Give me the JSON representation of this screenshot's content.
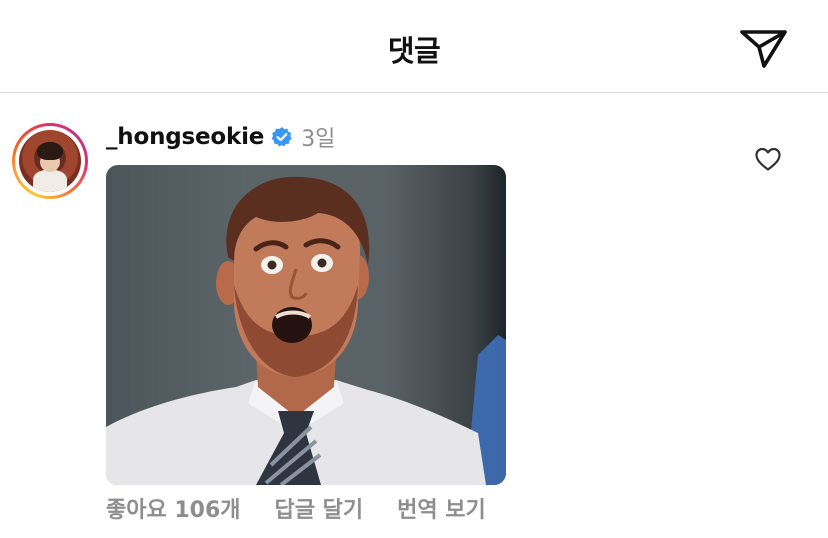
{
  "header": {
    "title": "댓글",
    "send_icon": "send-icon"
  },
  "comment": {
    "username": "_hongseokie",
    "verified_icon": "verified-badge-icon",
    "verified_color": "#3897f0",
    "timestamp": "3일",
    "like_icon": "heart-outline-icon",
    "media": "reaction-gif",
    "likes_text": "좋아요 106개",
    "reply_label": "답글 달기",
    "translate_label": "번역 보기"
  }
}
